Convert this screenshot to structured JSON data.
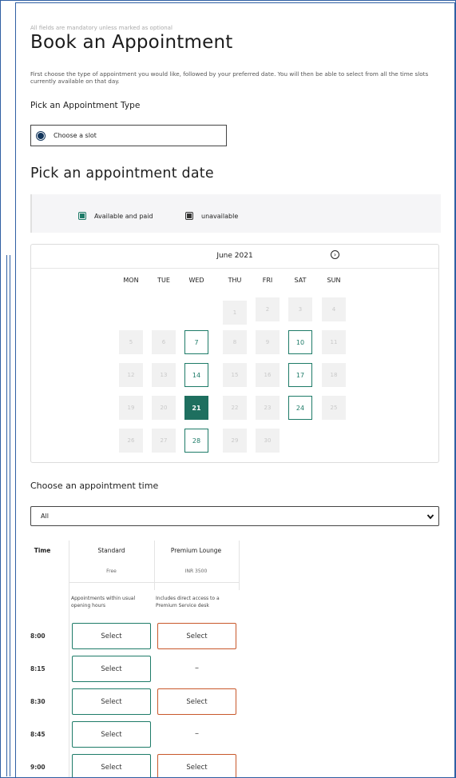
{
  "form": {
    "hint": "All fields are mandatory unless marked as optional",
    "title": "Book an Appointment",
    "intro": "First choose the type of appointment you would like, followed by your preferred date. You will then be able to select from all the time slots currently available on that day."
  },
  "appointment_type": {
    "label": "Pick an Appointment Type",
    "option_label": "Choose a slot",
    "selected": true
  },
  "date_picker": {
    "title": "Pick an appointment date",
    "legend": {
      "available": "Available and paid",
      "unavailable": "unavailable"
    },
    "month": "June 2021",
    "next_icon": "circle-arrow-right-icon",
    "weekdays": [
      "MON",
      "TUE",
      "WED",
      "THU",
      "FRI",
      "SAT",
      "SUN"
    ],
    "first_weekday_index": 3,
    "days_in_month": 30,
    "available_days": [
      7,
      10,
      14,
      17,
      21,
      24,
      28
    ],
    "selected_day": 21
  },
  "time_picker": {
    "title": "Choose an appointment time",
    "filter_value": "All",
    "time_header": "Time",
    "columns": [
      {
        "name": "Standard",
        "price": "Free",
        "description": "Appointments within usual opening hours"
      },
      {
        "name": "Premium Lounge",
        "price": "INR 3500",
        "description": "Includes direct access to a Premium Service desk"
      }
    ],
    "select_label": "Select",
    "unavailable_mark": "–",
    "rows": [
      {
        "time": "8:00",
        "standard": true,
        "premium": true
      },
      {
        "time": "8:15",
        "standard": true,
        "premium": false
      },
      {
        "time": "8:30",
        "standard": true,
        "premium": true
      },
      {
        "time": "8:45",
        "standard": true,
        "premium": false
      },
      {
        "time": "9:00",
        "standard": true,
        "premium": true
      }
    ]
  },
  "colors": {
    "accent": "#1e7b68",
    "premium": "#c8582b",
    "frame": "#2f5fa3",
    "radio": "#12355b"
  }
}
